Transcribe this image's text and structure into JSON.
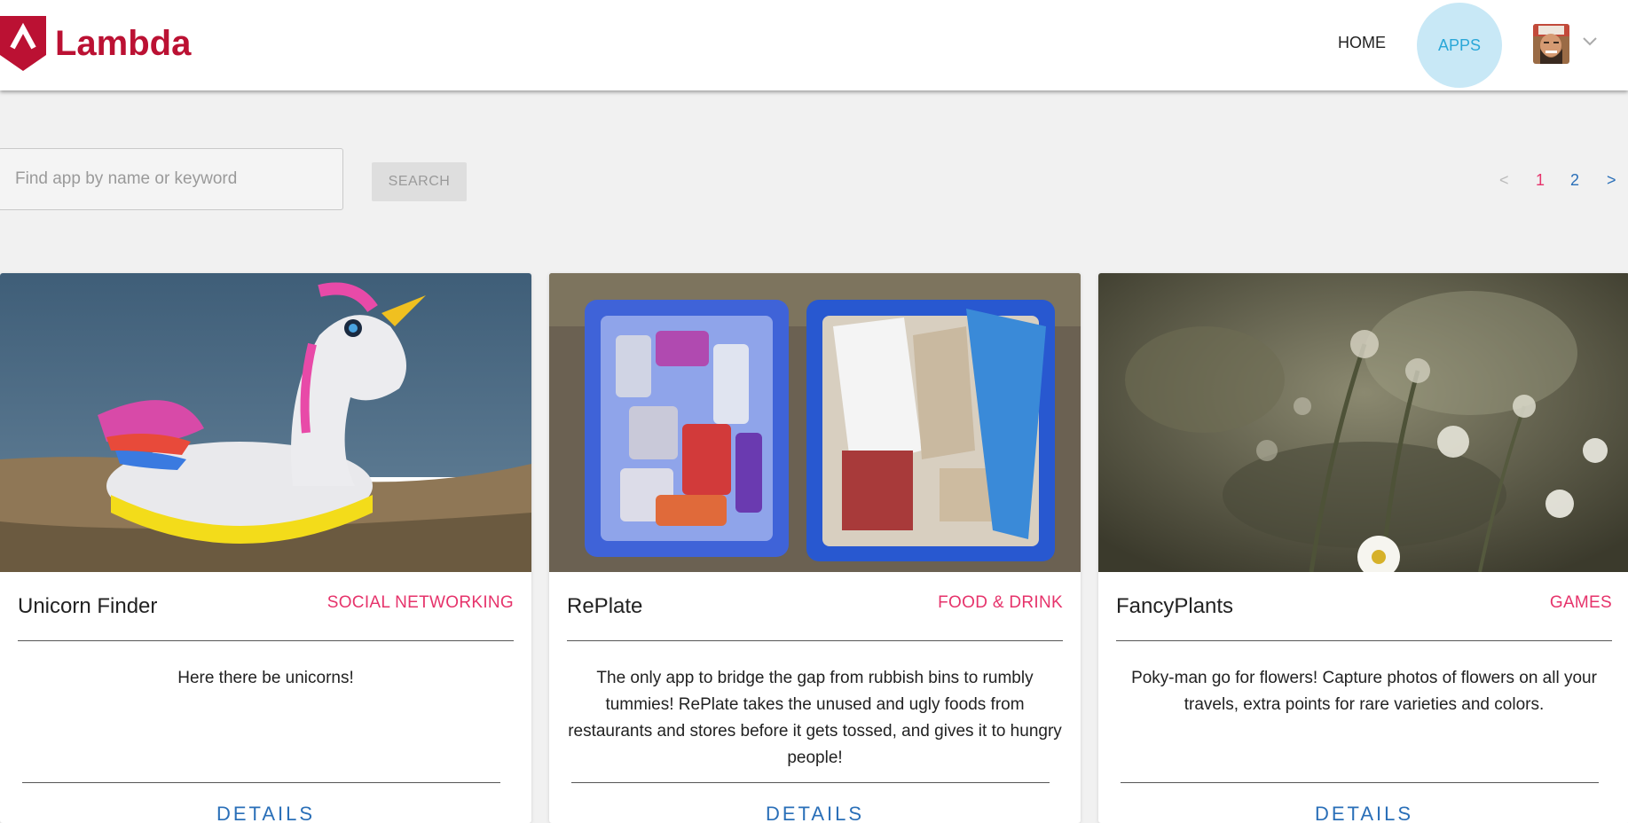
{
  "header": {
    "brand": "Lambda",
    "nav": {
      "home": "HOME",
      "apps": "APPS"
    }
  },
  "search": {
    "placeholder": "Find app by name or keyword",
    "value": "",
    "button": "SEARCH"
  },
  "pagination": {
    "prev": "<",
    "pages": [
      "1",
      "2"
    ],
    "current": "1",
    "next": ">"
  },
  "apps": [
    {
      "title": "Unicorn Finder",
      "category": "SOCIAL NETWORKING",
      "description": "Here there be unicorns!",
      "details": "DETAILS"
    },
    {
      "title": "RePlate",
      "category": "FOOD & DRINK",
      "description": "The only app to bridge the gap from rubbish bins to rumbly tummies! RePlate takes the unused and ugly foods from restaurants and stores before it gets tossed, and gives it to hungry people!",
      "details": "DETAILS"
    },
    {
      "title": "FancyPlants",
      "category": "GAMES",
      "description": "Poky-man go for flowers! Capture photos of flowers on all your travels, extra points for rare varieties and colors.",
      "details": "DETAILS"
    }
  ],
  "colors": {
    "brand": "#bb1133",
    "category": "#e6336b",
    "link": "#2a6fb8",
    "apps_highlight": "#c8e8f6"
  }
}
